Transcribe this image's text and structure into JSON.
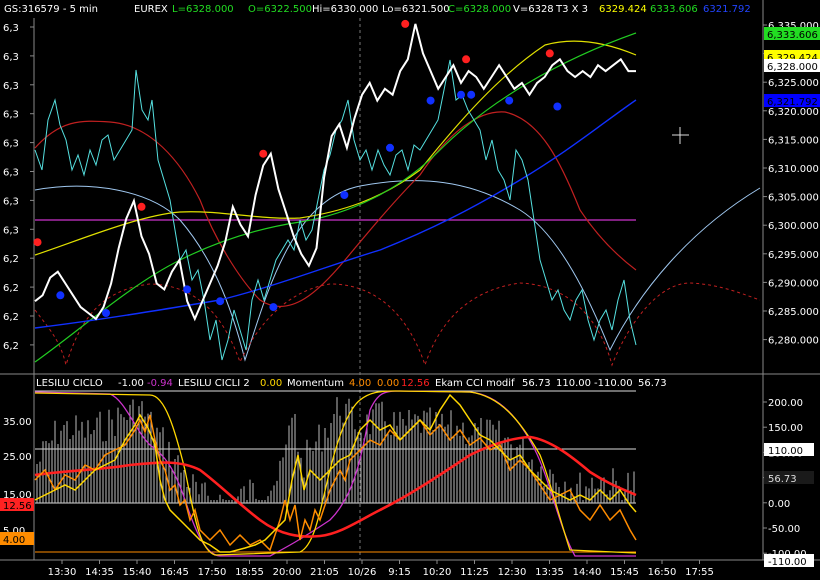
{
  "header": {
    "symbol": "GS:316579 - 5 min",
    "exchange": "EUREX",
    "last": "L=6328.000",
    "open": "O=6322.500",
    "high": "Hi=6330.000",
    "low": "Lo=6321.500",
    "close": "C=6328.000",
    "volume": "V=6328",
    "bars": "T3 X 3",
    "ind1": "6329.424",
    "ind2": "6333.606",
    "ind3": "6321.792"
  },
  "price_axis": {
    "ticks": [
      "6,335.000",
      "6,330.000",
      "6,325.000",
      "6,320.000",
      "6,315.000",
      "6,310.000",
      "6,305.000",
      "6,300.000",
      "6,295.000",
      "6,290.000",
      "6,285.000",
      "6,280.000"
    ],
    "left_ticks": [
      "6,3",
      "6,3",
      "6,3",
      "6,3",
      "6,3",
      "6,3",
      "6,3",
      "6,3",
      "6,2",
      "6,2",
      "6,2",
      "6,2"
    ],
    "badges": [
      {
        "text": "6,333.606",
        "bg": "#22dd22",
        "fg": "#000000"
      },
      {
        "text": "6,329.424",
        "bg": "#ffff00",
        "fg": "#000000"
      },
      {
        "text": "6,328.000",
        "bg": "#ffffff",
        "fg": "#000000"
      },
      {
        "text": "6,321.792",
        "bg": "#0000ff",
        "fg": "#000000"
      }
    ]
  },
  "osc_header": {
    "name1": "LESILU CICLO",
    "val1a": "-1.00",
    "val1b": "-0.94",
    "name2": "LESILU CICLI 2",
    "val2": "0.00",
    "name3": "Momentum",
    "val3a": "4.00",
    "val3b": "0.00",
    "val3c": "12.56",
    "name4": "Ekam CCI modif",
    "val4a": "56.73",
    "val4b": "110.00",
    "val4c": "-110.00",
    "val4d": "56.73"
  },
  "osc_axis": {
    "right_ticks": [
      "200.00",
      "150.00",
      "100.00",
      "50.00",
      "0.00",
      "-50.00",
      "-100.00"
    ],
    "left_ticks": [
      "35.00",
      "25.00",
      "15.00",
      "5.00"
    ],
    "right_badges": [
      {
        "text": "110.00",
        "bg": "#ffffff",
        "fg": "#000000"
      },
      {
        "text": "56.73",
        "bg": "#1a1a1a",
        "fg": "#dddddd"
      },
      {
        "text": "-110.00",
        "bg": "#ffffff",
        "fg": "#000000"
      }
    ],
    "left_badges": [
      {
        "text": "12.56",
        "bg": "#ff2222",
        "fg": "#000000"
      },
      {
        "text": "4.00",
        "bg": "#ff8c00",
        "fg": "#000000"
      }
    ]
  },
  "time_axis": [
    "13:30",
    "14:35",
    "15:40",
    "16:45",
    "17:50",
    "18:55",
    "20:00",
    "21:05",
    "10/26",
    "9:15",
    "10:20",
    "11:25",
    "12:30",
    "13:35",
    "14:40",
    "15:45",
    "16:50",
    "17:55"
  ],
  "colors": {
    "price": "#ffffff",
    "cyan": "#55e0e0",
    "red": "#c02020",
    "yellow": "#e0e000",
    "green": "#22cc22",
    "blue": "#1030ff",
    "lightblue": "#a0c8f0",
    "magenta": "#cc33cc",
    "osc_bars": "#bbbbbb",
    "osc_red": "#ff2020",
    "osc_orange": "#ff8c00",
    "osc_yellow": "#ffd700"
  },
  "chart_data": {
    "type": "line",
    "price_range": [
      6277,
      6337
    ],
    "price": [
      [
        0,
        6289
      ],
      [
        6,
        6290
      ],
      [
        12,
        6293
      ],
      [
        18,
        6294
      ],
      [
        24,
        6292
      ],
      [
        30,
        6290
      ],
      [
        36,
        6288
      ],
      [
        42,
        6287
      ],
      [
        48,
        6286
      ],
      [
        54,
        6288
      ],
      [
        60,
        6292
      ],
      [
        66,
        6298
      ],
      [
        72,
        6303
      ],
      [
        78,
        6306
      ],
      [
        84,
        6300
      ],
      [
        90,
        6297
      ],
      [
        96,
        6292
      ],
      [
        102,
        6291
      ],
      [
        108,
        6294
      ],
      [
        114,
        6296
      ],
      [
        120,
        6289
      ],
      [
        126,
        6286
      ],
      [
        132,
        6289
      ],
      [
        138,
        6292
      ],
      [
        144,
        6295
      ],
      [
        150,
        6299
      ],
      [
        156,
        6305
      ],
      [
        162,
        6302
      ],
      [
        168,
        6300
      ],
      [
        174,
        6307
      ],
      [
        180,
        6312
      ],
      [
        186,
        6314
      ],
      [
        192,
        6308
      ],
      [
        198,
        6304
      ],
      [
        204,
        6300
      ],
      [
        210,
        6297
      ],
      [
        216,
        6295
      ],
      [
        222,
        6298
      ],
      [
        228,
        6310
      ],
      [
        234,
        6317
      ],
      [
        240,
        6319
      ],
      [
        246,
        6315
      ],
      [
        252,
        6320
      ],
      [
        258,
        6324
      ],
      [
        264,
        6326
      ],
      [
        270,
        6323
      ],
      [
        276,
        6325
      ],
      [
        282,
        6324
      ],
      [
        288,
        6328
      ],
      [
        294,
        6330
      ],
      [
        300,
        6336
      ],
      [
        306,
        6331
      ],
      [
        312,
        6328
      ],
      [
        318,
        6325
      ],
      [
        324,
        6327
      ],
      [
        330,
        6329
      ],
      [
        336,
        6326
      ],
      [
        342,
        6328
      ],
      [
        348,
        6327
      ],
      [
        354,
        6325
      ],
      [
        360,
        6327
      ],
      [
        366,
        6329
      ],
      [
        372,
        6327
      ],
      [
        378,
        6325
      ],
      [
        384,
        6326
      ],
      [
        390,
        6324
      ],
      [
        396,
        6326
      ],
      [
        402,
        6327
      ],
      [
        408,
        6329
      ],
      [
        414,
        6330
      ],
      [
        420,
        6328
      ],
      [
        426,
        6327
      ],
      [
        432,
        6328
      ],
      [
        438,
        6327
      ],
      [
        444,
        6329
      ],
      [
        450,
        6328
      ],
      [
        456,
        6329
      ],
      [
        462,
        6330
      ],
      [
        468,
        6328
      ],
      [
        474,
        6328
      ]
    ],
    "red_dots": [
      [
        2,
        6299
      ],
      [
        84,
        6305
      ],
      [
        180,
        6314
      ],
      [
        292,
        6336
      ],
      [
        340,
        6330
      ],
      [
        406,
        6331
      ]
    ],
    "blue_dots": [
      [
        20,
        6290
      ],
      [
        56,
        6287
      ],
      [
        120,
        6291
      ],
      [
        146,
        6289
      ],
      [
        188,
        6288
      ],
      [
        244,
        6307
      ],
      [
        280,
        6315
      ],
      [
        312,
        6323
      ],
      [
        336,
        6324
      ],
      [
        344,
        6324
      ],
      [
        374,
        6323
      ],
      [
        412,
        6322
      ]
    ],
    "hline": 6301,
    "osc_range": [
      -110,
      230
    ]
  }
}
